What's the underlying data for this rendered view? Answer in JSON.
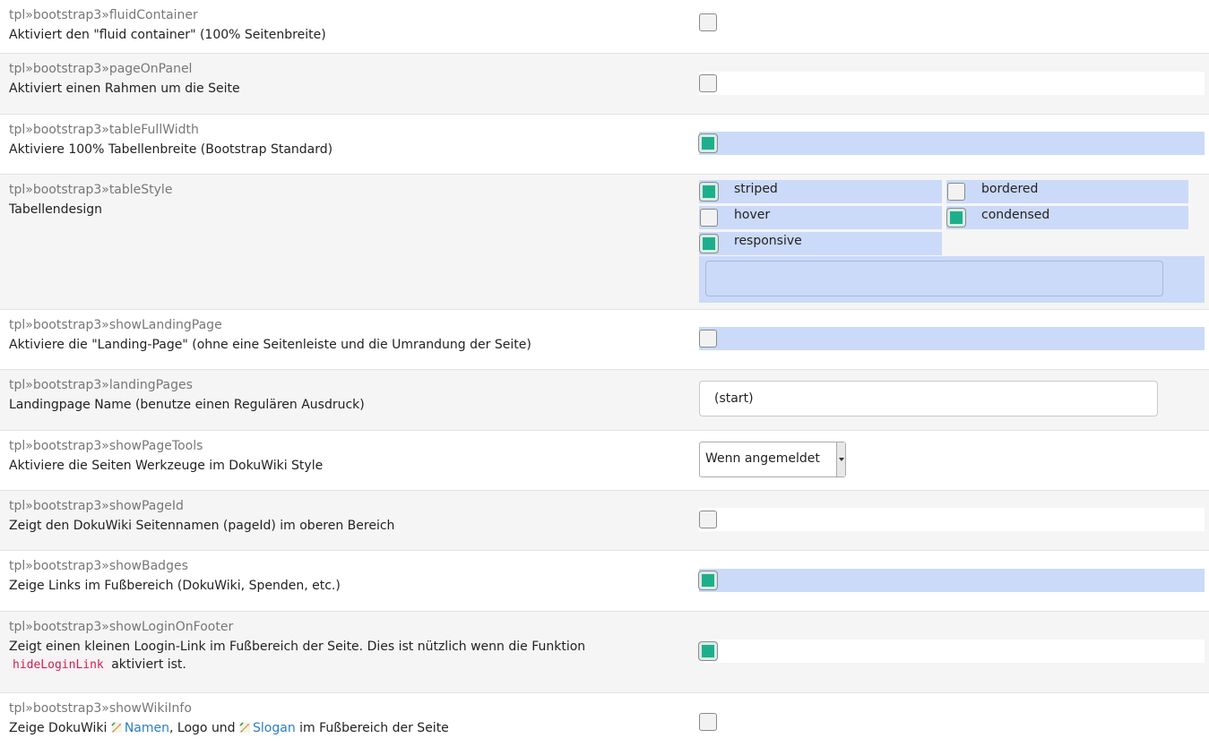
{
  "settings": [
    {
      "key": "tpl»bootstrap3»fluidContainer",
      "desc": "Aktiviert den \"fluid container\" (100% Seitenbreite)"
    },
    {
      "key": "tpl»bootstrap3»pageOnPanel",
      "desc": "Aktiviert einen Rahmen um die Seite"
    },
    {
      "key": "tpl»bootstrap3»tableFullWidth",
      "desc": "Aktiviere 100% Tabellenbreite (Bootstrap Standard)"
    },
    {
      "key": "tpl»bootstrap3»tableStyle",
      "desc": "Tabellendesign",
      "options": [
        {
          "label": "striped",
          "checked": true
        },
        {
          "label": "bordered",
          "checked": false
        },
        {
          "label": "hover",
          "checked": false
        },
        {
          "label": "condensed",
          "checked": true
        },
        {
          "label": "responsive",
          "checked": true
        }
      ],
      "extra_value": ""
    },
    {
      "key": "tpl»bootstrap3»showLandingPage",
      "desc": "Aktiviere die \"Landing-Page\" (ohne eine Seitenleiste und die Umrandung der Seite)"
    },
    {
      "key": "tpl»bootstrap3»landingPages",
      "desc": "Landingpage Name (benutze einen Regulären Ausdruck)",
      "value": "(start)"
    },
    {
      "key": "tpl»bootstrap3»showPageTools",
      "desc": "Aktiviere die Seiten Werkzeuge im DokuWiki Style",
      "selected": "Wenn angemeldet"
    },
    {
      "key": "tpl»bootstrap3»showPageId",
      "desc": "Zeigt den DokuWiki Seitennamen (pageId) im oberen Bereich"
    },
    {
      "key": "tpl»bootstrap3»showBadges",
      "desc": "Zeige Links im Fußbereich (DokuWiki, Spenden, etc.)"
    },
    {
      "key": "tpl»bootstrap3»showLoginOnFooter",
      "desc": "Zeigt einen kleinen Loogin-Link im Fußbereich der Seite. Dies ist nützlich wenn die Funktion",
      "code": "hideLoginLink",
      "desc_after": "aktiviert ist."
    },
    {
      "key": "tpl»bootstrap3»showWikiInfo",
      "desc_prefix": "Zeige DokuWiki",
      "link1": "Namen",
      "desc_mid": ", Logo und",
      "link2": "Slogan",
      "desc_suffix": "im Fußbereich der Seite"
    }
  ],
  "checkbox_states": {
    "fluidContainer": false,
    "pageOnPanel": false,
    "tableFullWidth": true,
    "showLandingPage": false,
    "showPageId": false,
    "showBadges": true,
    "showLoginOnFooter": true,
    "showWikiInfo": false
  },
  "colors": {
    "checked": "#1fae8c",
    "highlight": "#cbdaf8",
    "key_text": "#777777",
    "link": "#2a7dc7",
    "code_text": "#c7254e"
  }
}
